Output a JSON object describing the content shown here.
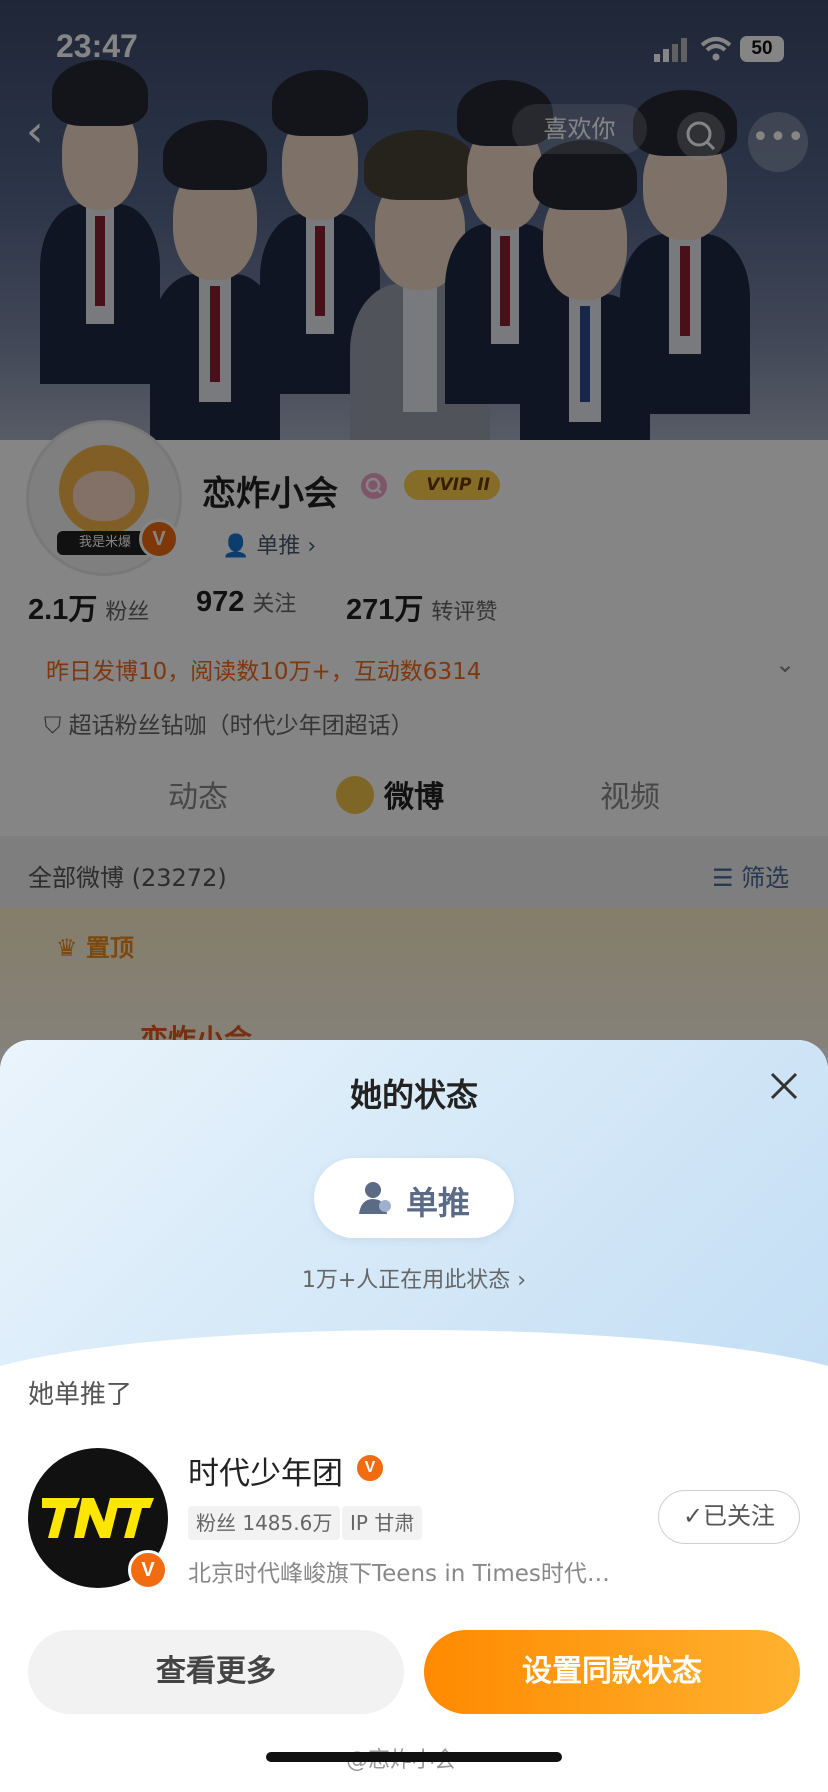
{
  "status_bar": {
    "time": "23:47",
    "battery": "50"
  },
  "banner": {
    "like_label": "喜欢你"
  },
  "profile": {
    "name": "恋炸小会",
    "vip_label": "VVIP II",
    "avatar_tag": "我是米爆",
    "status_tag": "单推 ›",
    "stats": [
      {
        "value": "2.1万",
        "label": "粉丝"
      },
      {
        "value": "972",
        "label": "关注"
      },
      {
        "value": "271万",
        "label": "转评赞"
      }
    ],
    "summary": "昨日发博10，阅读数10万+，互动数6314",
    "superfan": "超话粉丝钻咖（时代少年团超话）",
    "tabs": [
      "动态",
      "微博",
      "视频"
    ],
    "all_weibo": "全部微博 (23272)",
    "filter": "筛选",
    "pinned": "置顶",
    "pinned_name": "恋炸小会"
  },
  "sheet": {
    "title": "她的状态",
    "status_label": "单推",
    "users_count": "1万+人正在用此状态 ›",
    "section": "她单推了",
    "account": {
      "name": "时代少年团",
      "fans_chip": "粉丝 1485.6万",
      "ip_chip": "IP 甘肃",
      "desc": "北京时代峰峻旗下Teens in Times时代…",
      "follow_label": "已关注"
    },
    "more_button": "查看更多",
    "set_button": "设置同款状态"
  },
  "watermark": "@恋炸小会",
  "colors": {
    "accent": "#ff8a00",
    "orange_text": "#f26b1d",
    "verified": "#f16b10"
  }
}
